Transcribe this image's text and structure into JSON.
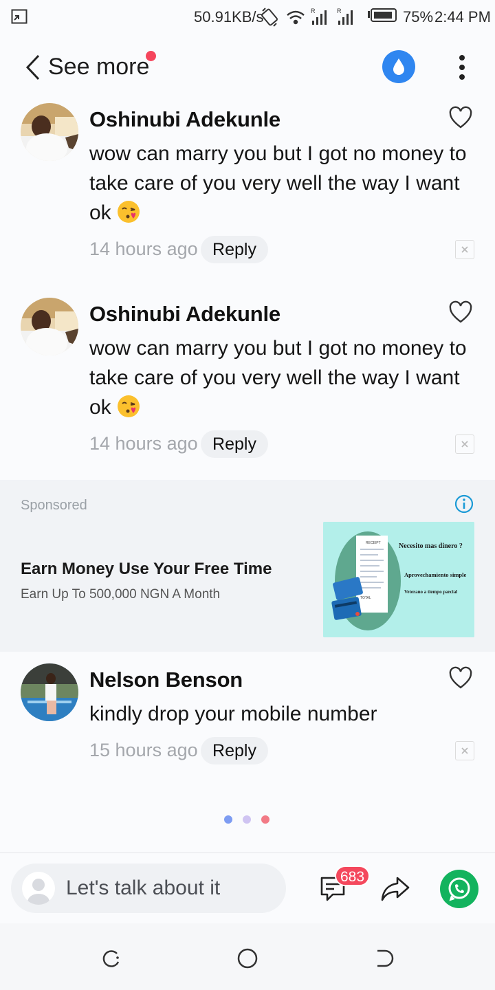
{
  "status_bar": {
    "network_speed": "50.91KB/s",
    "battery_percent": "75%",
    "time": "2:44 PM",
    "icons": [
      "screen-cast-icon",
      "rotate-icon",
      "wifi-icon",
      "signal-icon",
      "signal-icon-2",
      "battery-icon"
    ]
  },
  "header": {
    "back_label": "See more",
    "notification_dot_color": "#f5455c",
    "drop_button_color": "#2f86f0"
  },
  "comments": [
    {
      "author": "Oshinubi Adekunle",
      "text": "wow can marry you but I got no money to take care of you very well the way I want ok",
      "emoji": "kissing-wink-emoji",
      "time": "14 hours ago",
      "reply_label": "Reply"
    },
    {
      "author": "Oshinubi Adekunle",
      "text": "wow can marry you but I got no money to take care of you very well the way I want ok",
      "emoji": "kissing-wink-emoji",
      "time": "14 hours ago",
      "reply_label": "Reply"
    },
    {
      "author": "Nelson Benson",
      "text": "kindly drop your mobile number",
      "time": "15 hours ago",
      "reply_label": "Reply"
    }
  ],
  "sponsored": {
    "label": "Sponsored",
    "title": "Earn Money Use Your Free Time",
    "subtitle": "Earn Up To 500,000 NGN A Month",
    "image_texts": {
      "line1": "Necesito mas dinero ?",
      "line2": "Aprovechamiento simple",
      "line3": "Veterano a tiempo parcial",
      "receipt": "RECEIPT",
      "total": "TOTAL"
    }
  },
  "pager": {
    "colors": [
      "#7d9cf2",
      "#cfc4f2",
      "#f27a86"
    ]
  },
  "bottom_bar": {
    "input_placeholder": "Let's talk about it",
    "comment_count": "683",
    "whatsapp_color": "#13b35e"
  }
}
